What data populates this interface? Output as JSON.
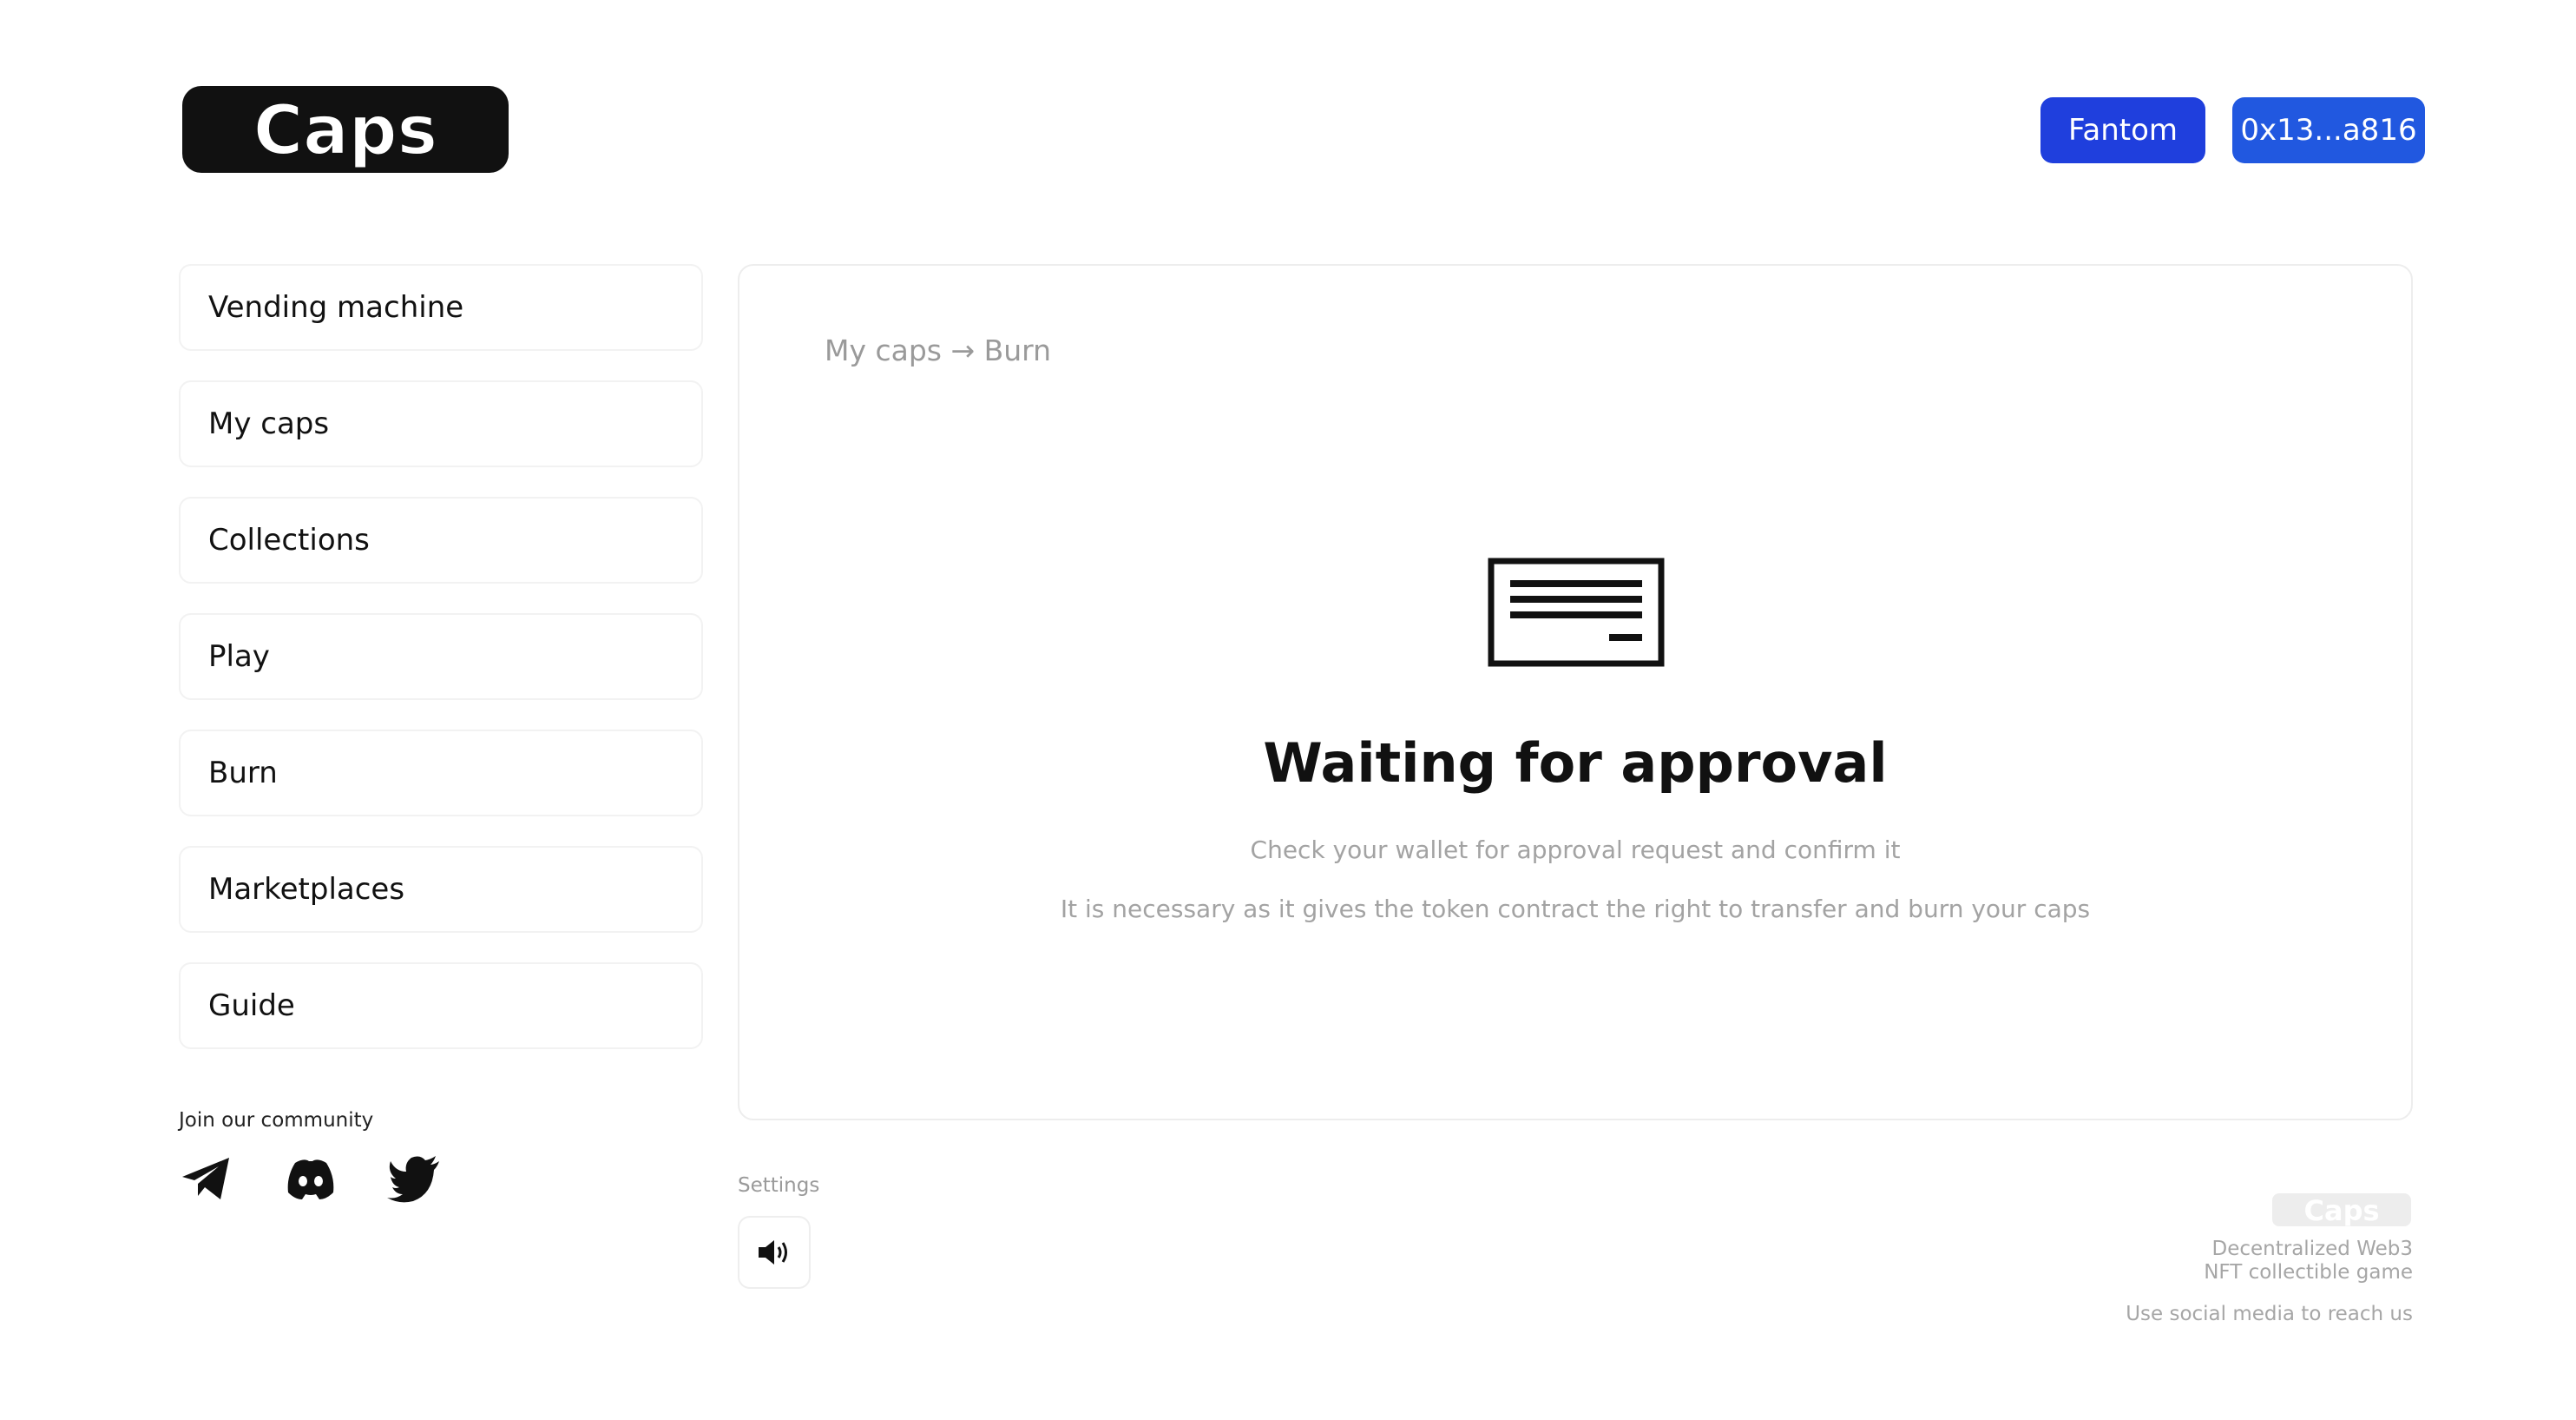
{
  "header": {
    "logo_text": "Caps",
    "network_button": "Fantom",
    "wallet_button": "0x13...a816"
  },
  "sidebar": {
    "items": [
      {
        "label": "Vending machine"
      },
      {
        "label": "My caps"
      },
      {
        "label": "Collections"
      },
      {
        "label": "Play"
      },
      {
        "label": "Burn"
      },
      {
        "label": "Marketplaces"
      },
      {
        "label": "Guide"
      }
    ],
    "community_label": "Join our community",
    "social_icons": [
      "telegram-icon",
      "discord-icon",
      "twitter-icon"
    ]
  },
  "main": {
    "breadcrumb": "My caps → Burn",
    "icon": "card-icon",
    "title": "Waiting for approval",
    "line1": "Check your wallet for approval request and confirm it",
    "line2": "It is necessary as it gives the token contract the right to transfer and burn your caps"
  },
  "settings": {
    "label": "Settings",
    "sound_icon": "speaker-icon"
  },
  "footer": {
    "logo_text": "Caps",
    "tagline_1": "Decentralized Web3",
    "tagline_2": "NFT collectible game",
    "contact": "Use social media to reach us"
  },
  "colors": {
    "network_button": "#1f3fdd",
    "wallet_button": "#2158e0",
    "muted_text": "#a3a3a3"
  }
}
